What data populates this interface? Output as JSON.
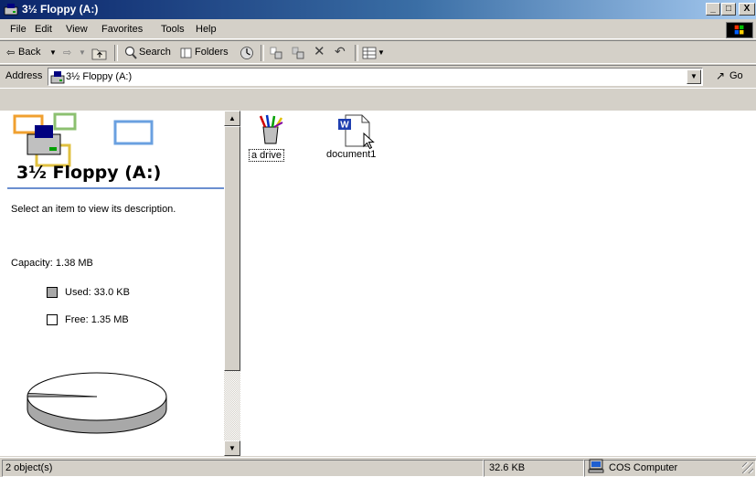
{
  "window": {
    "title": "3½ Floppy (A:)",
    "buttons": {
      "minimize": "_",
      "maximize": "□",
      "close": "X"
    }
  },
  "menu": {
    "items": [
      "File",
      "Edit",
      "View",
      "Favorites",
      "Tools",
      "Help"
    ]
  },
  "toolbar": {
    "back": "Back",
    "forward_arrow": "⇨",
    "up_icon": "up-folder-icon",
    "search": "Search",
    "folders": "Folders"
  },
  "address": {
    "label": "Address",
    "value": "3½ Floppy (A:)",
    "go": "Go"
  },
  "left_pane": {
    "title": "3½ Floppy (A:)",
    "hint": "Select an item to view its description.",
    "capacity": "Capacity: 1.38 MB",
    "used": "Used: 33.0 KB",
    "free": "Free: 1.35 MB",
    "used_fraction": 0.023
  },
  "files": [
    {
      "name": "a drive",
      "icon": "program-icon",
      "selected": true
    },
    {
      "name": "document1",
      "icon": "word-document-icon",
      "selected": false
    }
  ],
  "status": {
    "objects": "2 object(s)",
    "size": "32.6 KB",
    "computer": "COS Computer"
  },
  "colors": {
    "title_gradient_start": "#0a246a",
    "title_gradient_end": "#a6caf0",
    "window_face": "#d4d0c8",
    "accent_line": "#6b8fd0"
  }
}
